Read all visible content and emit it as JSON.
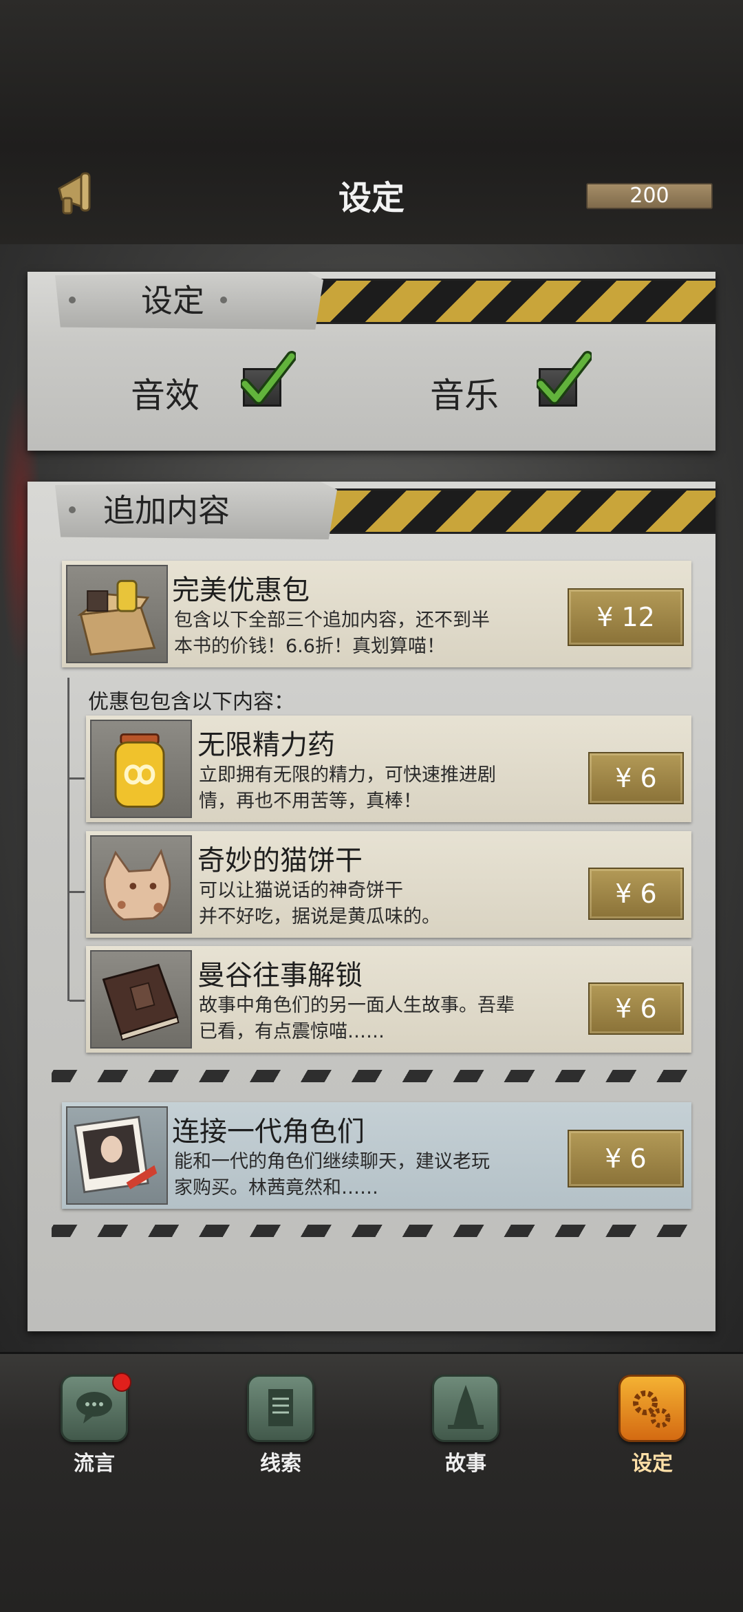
{
  "header": {
    "title": "设定",
    "coins": "200",
    "icon": "megaphone-icon"
  },
  "settings": {
    "tab_label": "设定",
    "sound_label": "音效",
    "sound_checked": true,
    "music_label": "音乐",
    "music_checked": true
  },
  "addons": {
    "tab_label": "追加内容",
    "bundle": {
      "title": "完美优惠包",
      "desc_line1": "包含以下全部三个追加内容，还不到半",
      "desc_line2": "本书的价钱！6.6折！真划算喵！",
      "price": "¥ 12"
    },
    "bundle_includes_label": "优惠包包含以下内容：",
    "items": [
      {
        "title": "无限精力药",
        "desc_line1": "立即拥有无限的精力，可快速推进剧",
        "desc_line2": "情，再也不用苦等，真棒！",
        "price": "¥ 6"
      },
      {
        "title": "奇妙的猫饼干",
        "desc_line1": "可以让猫说话的神奇饼干",
        "desc_line2": "并不好吃，据说是黄瓜味的。",
        "price": "¥ 6"
      },
      {
        "title": "曼谷往事解锁",
        "desc_line1": "故事中角色们的另一面人生故事。吾辈",
        "desc_line2": "已看，有点震惊喵……",
        "price": "¥ 6"
      }
    ],
    "connect": {
      "title": "连接一代角色们",
      "desc_line1": "能和一代的角色们继续聊天，建议老玩",
      "desc_line2": "家购买。林茜竟然和……",
      "price": "¥ 6"
    }
  },
  "nav": [
    {
      "label": "流言",
      "icon": "chat-bubble-icon",
      "badge": true
    },
    {
      "label": "线索",
      "icon": "scroll-icon"
    },
    {
      "label": "故事",
      "icon": "temple-icon"
    },
    {
      "label": "设定",
      "icon": "gears-icon",
      "active": true
    }
  ]
}
